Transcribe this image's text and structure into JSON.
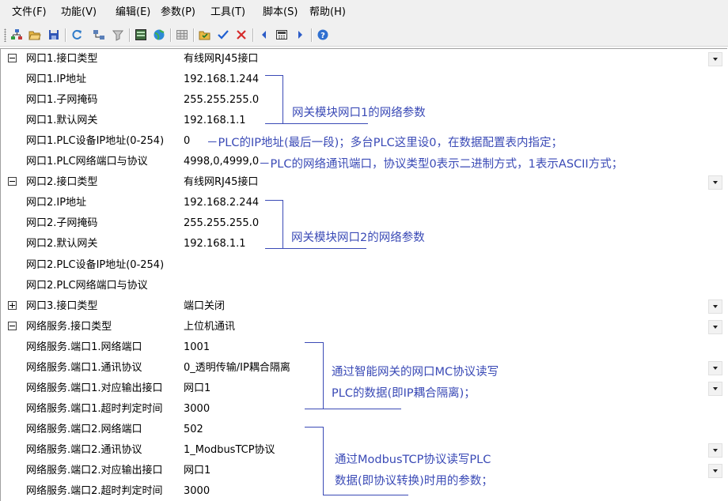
{
  "menu": {
    "items": [
      {
        "id": "file",
        "label": "文件(F)"
      },
      {
        "id": "function",
        "label": "功能(V)"
      },
      {
        "id": "edit",
        "label": "编辑(E)"
      },
      {
        "id": "params",
        "label": "参数(P)"
      },
      {
        "id": "tools",
        "label": "工具(T)"
      },
      {
        "id": "script",
        "label": "脚本(S)"
      },
      {
        "id": "help",
        "label": "帮助(H)"
      }
    ]
  },
  "toolbar": {
    "icons": [
      "tree-icon",
      "open-folder-icon",
      "save-icon",
      "refresh-icon",
      "network-icon",
      "filter-icon",
      "panel-icon",
      "globe-icon",
      "grid-icon",
      "folder-check-icon",
      "checkmark-icon",
      "cross-icon",
      "arrow-left-icon",
      "calculator-icon",
      "arrow-right-icon",
      "help-icon"
    ]
  },
  "rows": [
    {
      "name": "网口1.接口类型",
      "value": "有线网RJ45接口",
      "group": "minus",
      "dropdown": true
    },
    {
      "name": "网口1.IP地址",
      "value": "192.168.1.244"
    },
    {
      "name": "网口1.子网掩码",
      "value": "255.255.255.0"
    },
    {
      "name": "网口1.默认网关",
      "value": "192.168.1.1"
    },
    {
      "name": "网口1.PLC设备IP地址(0-254)",
      "value": "0"
    },
    {
      "name": "网口1.PLC网络端口与协议",
      "value": "4998,0,4999,0"
    },
    {
      "name": "网口2.接口类型",
      "value": "有线网RJ45接口",
      "group": "minus",
      "dropdown": true
    },
    {
      "name": "网口2.IP地址",
      "value": "192.168.2.244"
    },
    {
      "name": "网口2.子网掩码",
      "value": "255.255.255.0"
    },
    {
      "name": "网口2.默认网关",
      "value": "192.168.1.1"
    },
    {
      "name": "网口2.PLC设备IP地址(0-254)",
      "value": ""
    },
    {
      "name": "网口2.PLC网络端口与协议",
      "value": ""
    },
    {
      "name": "网口3.接口类型",
      "value": "端口关闭",
      "group": "plus",
      "dropdown": true
    },
    {
      "name": "网络服务.接口类型",
      "value": "上位机通讯",
      "group": "minus",
      "dropdown": true
    },
    {
      "name": "网络服务.端口1.网络端口",
      "value": "1001"
    },
    {
      "name": "网络服务.端口1.通讯协议",
      "value": "0_透明传输/IP耦合隔离",
      "dropdown": true
    },
    {
      "name": "网络服务.端口1.对应输出接口",
      "value": "网口1",
      "dropdown": true
    },
    {
      "name": "网络服务.端口1.超时判定时间",
      "value": "3000"
    },
    {
      "name": "网络服务.端口2.网络端口",
      "value": "502"
    },
    {
      "name": "网络服务.端口2.通讯协议",
      "value": "1_ModbusTCP协议",
      "dropdown": true
    },
    {
      "name": "网络服务.端口2.对应输出接口",
      "value": "网口1",
      "dropdown": true
    },
    {
      "name": "网络服务.端口2.超时判定时间",
      "value": "3000"
    }
  ],
  "annotations": {
    "port1_params": "网关模块网口1的网络参数",
    "plc_ip_note": "－PLC的IP地址(最后一段)；多台PLC这里设0，在数据配置表内指定；",
    "plc_port_note": "－PLC的网络通讯端口，协议类型0表示二进制方式，1表示ASCII方式；",
    "port2_params": "网关模块网口2的网络参数",
    "mc_line1": "通过智能网关的网口MC协议读写",
    "mc_line2": "PLC的数据(即IP耦合隔离)；",
    "modbus_line1": "通过ModbusTCP协议读写PLC",
    "modbus_line2": "数据(即协议转换)时用的参数；"
  },
  "colors": {
    "annotation": "#3a4ab6",
    "value_blue": "#1b1b9a"
  }
}
